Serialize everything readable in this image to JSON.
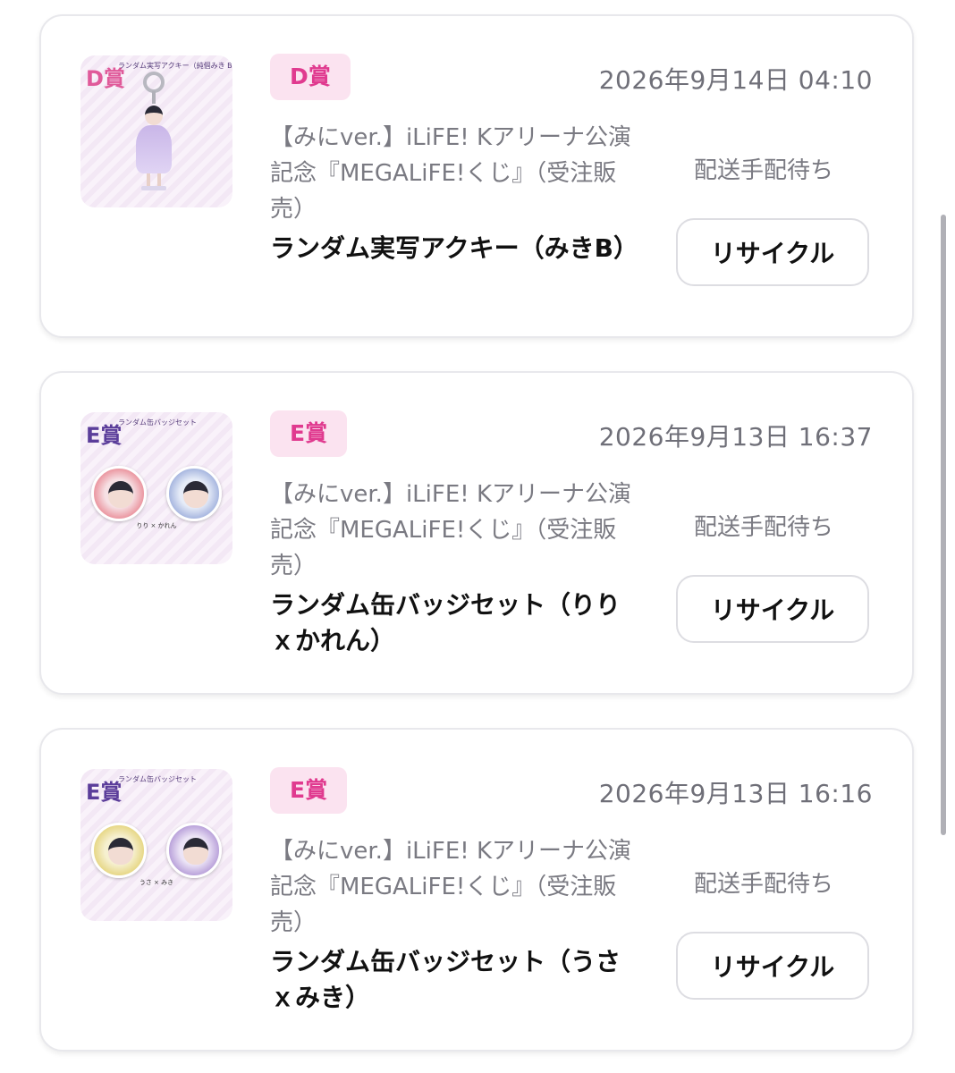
{
  "cards": [
    {
      "prize": "D賞",
      "date": "2026年9月14日 04:10",
      "campaign": "【みにver.】iLiFE! Kアリーナ公演記念『MEGALiFE!くじ』（受注販売）",
      "item": "ランダム実写アクキー（みきB）",
      "status": "配送手配待ち",
      "button": "リサイクル",
      "thumbnail": {
        "letter": "D賞",
        "title": "ランダム実写アクキー（純個みき B）",
        "icon": "acrylic-keychain-icon"
      }
    },
    {
      "prize": "E賞",
      "date": "2026年9月13日 16:37",
      "campaign": "【みにver.】iLiFE! Kアリーナ公演記念『MEGALiFE!くじ』（受注販売）",
      "item": "ランダム缶バッジセット（りりｘかれん）",
      "status": "配送手配待ち",
      "button": "リサイクル",
      "thumbnail": {
        "letter": "E賞",
        "title": "ランダム缶バッジセット",
        "caption": "りり × かれん",
        "icon": "can-badge-icon"
      }
    },
    {
      "prize": "E賞",
      "date": "2026年9月13日 16:16",
      "campaign": "【みにver.】iLiFE! Kアリーナ公演記念『MEGALiFE!くじ』（受注販売）",
      "item": "ランダム缶バッジセット（うさｘみき）",
      "status": "配送手配待ち",
      "button": "リサイクル",
      "thumbnail": {
        "letter": "E賞",
        "title": "ランダム缶バッジセット",
        "caption": "うさ × みき",
        "icon": "can-badge-icon"
      }
    }
  ],
  "colors": {
    "prize_tag_bg": "#fbe3f0",
    "prize_tag_text": "#e03a8f",
    "muted_text": "#7a7a82",
    "card_border": "#e8e8ec"
  }
}
